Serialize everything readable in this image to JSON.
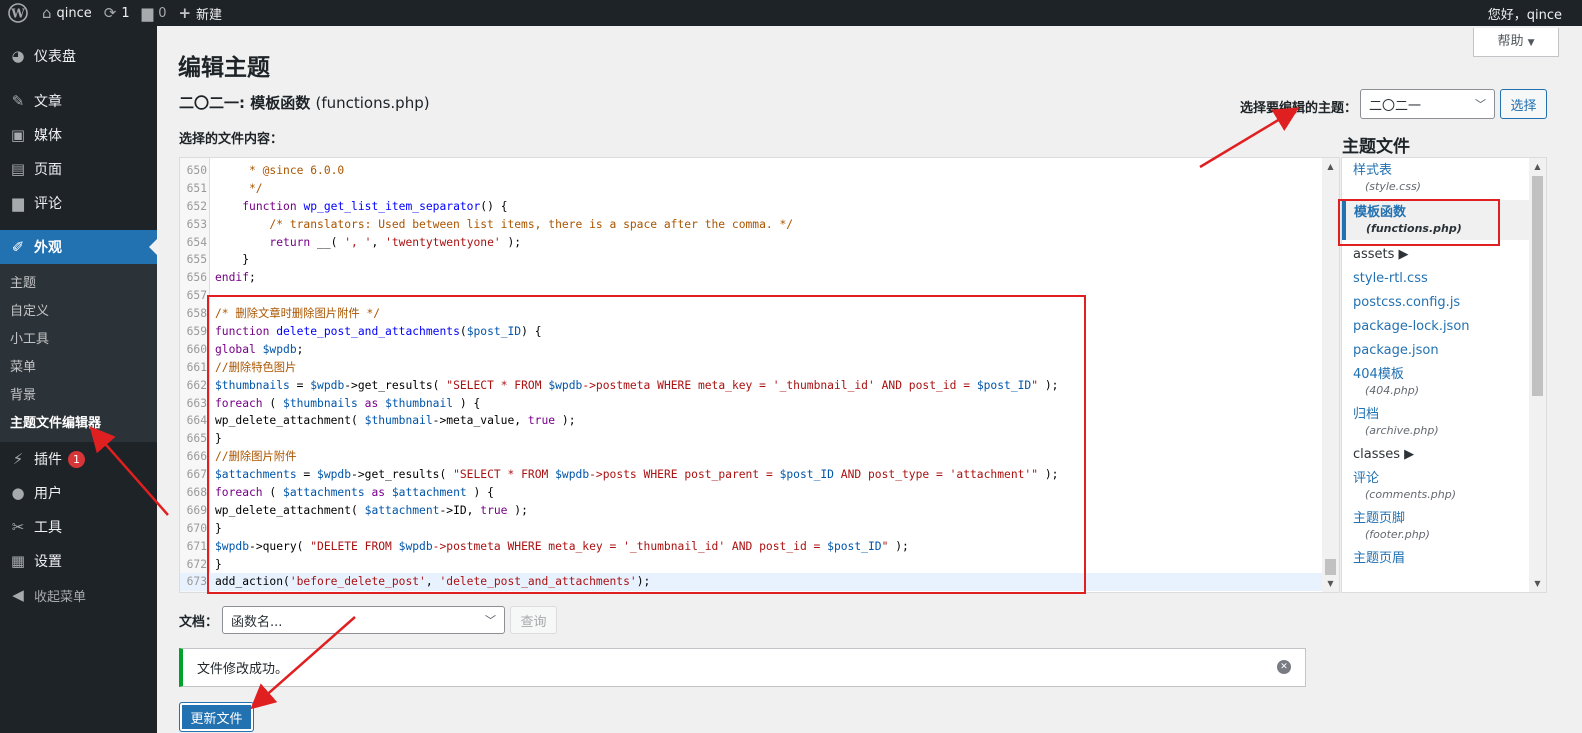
{
  "adminbar": {
    "site_name": "qince",
    "updates_count": "1",
    "comments_count": "0",
    "new_label": "新建",
    "greeting": "您好，qince"
  },
  "sidebar": {
    "dashboard": "仪表盘",
    "posts": "文章",
    "media": "媒体",
    "pages": "页面",
    "comments": "评论",
    "appearance": "外观",
    "appearance_sub": [
      "主题",
      "自定义",
      "小工具",
      "菜单",
      "背景",
      "主题文件编辑器"
    ],
    "plugins": "插件",
    "plugins_badge": "1",
    "users": "用户",
    "tools": "工具",
    "settings": "设置",
    "collapse": "收起菜单"
  },
  "help_label": "帮助",
  "page_title": "编辑主题",
  "subtitle_theme": "二〇二一: 模板函数",
  "subtitle_file": "(functions.php)",
  "theme_select": {
    "label": "选择要编辑的主题：",
    "value": "二〇二一",
    "button": "选择"
  },
  "file_content_label": "选择的文件内容：",
  "code_lines": [
    {
      "n": "650",
      "t": "     * @since 6.0.0"
    },
    {
      "n": "651",
      "t": "     */"
    },
    {
      "n": "652",
      "t": "    function wp_get_list_item_separator() {"
    },
    {
      "n": "653",
      "t": "        /* translators: Used between list items, there is a space after the comma. */"
    },
    {
      "n": "654",
      "t": "        return __( ', ', 'twentytwentyone' );"
    },
    {
      "n": "655",
      "t": "    }"
    },
    {
      "n": "656",
      "t": "endif;"
    },
    {
      "n": "657",
      "t": ""
    },
    {
      "n": "658",
      "t": "/* 删除文章时删除图片附件 */"
    },
    {
      "n": "659",
      "t": "function delete_post_and_attachments($post_ID) {"
    },
    {
      "n": "660",
      "t": "global $wpdb;"
    },
    {
      "n": "661",
      "t": "//删除特色图片"
    },
    {
      "n": "662",
      "t": "$thumbnails = $wpdb->get_results( \"SELECT * FROM $wpdb->postmeta WHERE meta_key = '_thumbnail_id' AND post_id = $post_ID\" );"
    },
    {
      "n": "663",
      "t": "foreach ( $thumbnails as $thumbnail ) {"
    },
    {
      "n": "664",
      "t": "wp_delete_attachment( $thumbnail->meta_value, true );"
    },
    {
      "n": "665",
      "t": "}"
    },
    {
      "n": "666",
      "t": "//删除图片附件"
    },
    {
      "n": "667",
      "t": "$attachments = $wpdb->get_results( \"SELECT * FROM $wpdb->posts WHERE post_parent = $post_ID AND post_type = 'attachment'\" );"
    },
    {
      "n": "668",
      "t": "foreach ( $attachments as $attachment ) {"
    },
    {
      "n": "669",
      "t": "wp_delete_attachment( $attachment->ID, true );"
    },
    {
      "n": "670",
      "t": "}"
    },
    {
      "n": "671",
      "t": "$wpdb->query( \"DELETE FROM $wpdb->postmeta WHERE meta_key = '_thumbnail_id' AND post_id = $post_ID\" );"
    },
    {
      "n": "672",
      "t": "}"
    },
    {
      "n": "673",
      "t": "add_action('before_delete_post', 'delete_post_and_attachments');"
    }
  ],
  "theme_files": {
    "title": "主题文件",
    "items": [
      {
        "name": "样式表",
        "file": "(style.css)"
      },
      {
        "name": "模板函数",
        "file": "(functions.php)",
        "current": true
      },
      {
        "name": "assets ▶",
        "folder": true
      },
      {
        "name": "style-rtl.css"
      },
      {
        "name": "postcss.config.js"
      },
      {
        "name": "package-lock.json"
      },
      {
        "name": "package.json"
      },
      {
        "name": "404模板",
        "file": "(404.php)"
      },
      {
        "name": "归档",
        "file": "(archive.php)"
      },
      {
        "name": "classes ▶",
        "folder": true
      },
      {
        "name": "评论",
        "file": "(comments.php)"
      },
      {
        "name": "主题页脚",
        "file": "(footer.php)"
      },
      {
        "name": "主题页眉",
        "file": ""
      }
    ]
  },
  "docs": {
    "label": "文档：",
    "placeholder": "函数名...",
    "lookup_button": "查询"
  },
  "notice_text": "文件修改成功。",
  "update_button": "更新文件",
  "colors": {
    "admin_dark": "#1d2327",
    "accent": "#2271b1",
    "success": "#00a32a",
    "annotation_red": "#e02020"
  }
}
